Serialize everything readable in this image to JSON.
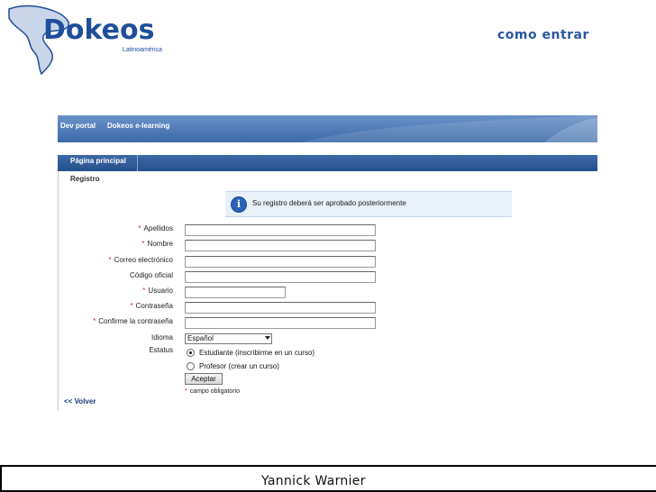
{
  "slide": {
    "title": "como entrar",
    "logo_text": "Dokeos",
    "logo_sub": "Latinoamérica",
    "footer": "Yannick Warnier"
  },
  "app": {
    "topbar": {
      "portal": "Dev portal",
      "site": "Dokeos e-learning"
    },
    "nav_tab": "Página principal",
    "breadcrumb": "Registro",
    "notice": "Su registro deberá ser aprobado posteriormente",
    "form": {
      "required_mark": "*",
      "fields": [
        {
          "label": "Apellidos",
          "required": true,
          "value": ""
        },
        {
          "label": "Nombre",
          "required": true,
          "value": ""
        },
        {
          "label": "Correo electrónico",
          "required": true,
          "value": ""
        },
        {
          "label": "Código oficial",
          "required": false,
          "value": ""
        },
        {
          "label": "Usuario",
          "required": true,
          "value": ""
        },
        {
          "label": "Contraseña",
          "required": true,
          "value": ""
        },
        {
          "label": "Confirme la contraseña",
          "required": true,
          "value": ""
        }
      ],
      "language": {
        "label": "Idioma",
        "value": "Español"
      },
      "status": {
        "label": "Estatus",
        "options": [
          {
            "label": "Estudiante (inscribirme en un curso)",
            "selected": true
          },
          {
            "label": "Profesor (crear un curso)",
            "selected": false
          }
        ]
      },
      "submit_label": "Aceptar",
      "required_note": "campo obligatorio"
    },
    "back_link": "<< Volver"
  },
  "colors": {
    "brand_blue": "#1f4e9a",
    "required_red": "#e02020",
    "bar_blue": "#3a6aa8"
  }
}
